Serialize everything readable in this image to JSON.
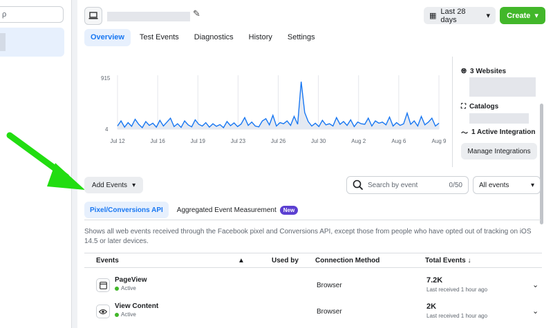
{
  "sidebar": {
    "search_placeholder": "ρ"
  },
  "header": {
    "device_icon": "laptop-icon",
    "edit_icon": "pencil-icon",
    "date_range": "Last 28 days",
    "create_label": "Create"
  },
  "tabs": [
    {
      "label": "Overview",
      "active": true
    },
    {
      "label": "Test Events"
    },
    {
      "label": "Diagnostics"
    },
    {
      "label": "History"
    },
    {
      "label": "Settings"
    }
  ],
  "chart_data": {
    "type": "line",
    "y_ticks": [
      "915",
      "4"
    ],
    "ylim": [
      4,
      915
    ],
    "x_ticks": [
      "Jul 12",
      "Jul 16",
      "Jul 19",
      "Jul 23",
      "Jul 26",
      "Jul 30",
      "Aug 2",
      "Aug 6",
      "Aug 9"
    ],
    "values": [
      60,
      150,
      40,
      120,
      55,
      180,
      90,
      30,
      140,
      70,
      110,
      40,
      160,
      60,
      130,
      200,
      50,
      100,
      35,
      150,
      80,
      45,
      170,
      90,
      60,
      120,
      40,
      100,
      55,
      85,
      30,
      140,
      65,
      115,
      50,
      95,
      210,
      70,
      130,
      60,
      45,
      150,
      190,
      80,
      250,
      60,
      120,
      100,
      150,
      70,
      230,
      90,
      850,
      300,
      140,
      60,
      110,
      50,
      160,
      80,
      100,
      60,
      210,
      90,
      140,
      70,
      170,
      50,
      130,
      100,
      90,
      200,
      60,
      150,
      110,
      130,
      80,
      220,
      60,
      120,
      70,
      100,
      290,
      90,
      150,
      60,
      230,
      80,
      130,
      200,
      60,
      110
    ],
    "grid": true,
    "color": "#1877f2"
  },
  "right_panel": {
    "websites": "3 Websites",
    "catalogs": "Catalogs",
    "integrations": "1 Active Integration",
    "manage_label": "Manage Integrations"
  },
  "events": {
    "add_label": "Add Events",
    "search_placeholder": "Search by event",
    "search_count": "0/50",
    "filter_label": "All events",
    "subtab_active": "Pixel/Conversions API",
    "subtab_other": "Aggregated Event Measurement",
    "new_badge": "New",
    "description": "Shows all web events received through the Facebook pixel and Conversions API, except those from people who have opted out of tracking on iOS 14.5 or later devices.",
    "columns": {
      "events": "Events",
      "used_by": "Used by",
      "method": "Connection Method",
      "total": "Total Events ↓"
    },
    "rows": [
      {
        "icon": "page-icon",
        "name": "PageView",
        "status": "Active",
        "method": "Browser",
        "total": "7.2K",
        "last": "Last received 1 hour ago"
      },
      {
        "icon": "eye-icon",
        "name": "View Content",
        "status": "Active",
        "method": "Browser",
        "total": "2K",
        "last": "Last received 1 hour ago"
      }
    ]
  },
  "colors": {
    "accent": "#1877f2",
    "create": "#42b72a",
    "annotation_arrow": "#22dd11",
    "badge": "#5b3fd1"
  }
}
